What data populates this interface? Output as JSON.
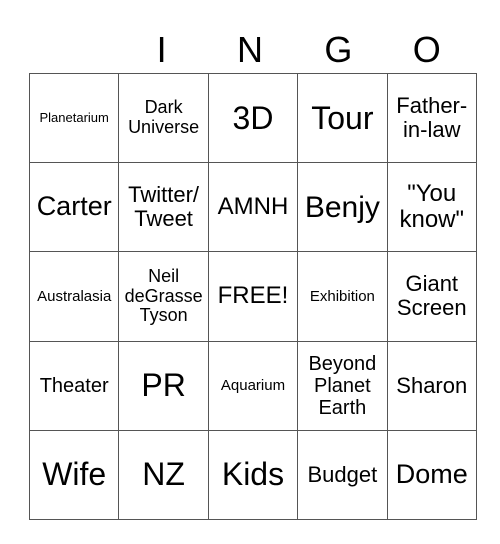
{
  "header": {
    "letters": [
      "",
      "I",
      "N",
      "G",
      "O"
    ]
  },
  "board": {
    "rows": [
      [
        "Planetarium",
        "Dark\nUniverse",
        "3D",
        "Tour",
        "Father-\nin-law"
      ],
      [
        "Carter",
        "Twitter/\nTweet",
        "AMNH",
        "Benjy",
        "\"You\nknow\""
      ],
      [
        "Australasia",
        "Neil\ndeGrasse\nTyson",
        "FREE!",
        "Exhibition",
        "Giant\nScreen"
      ],
      [
        "Theater",
        "PR",
        "Aquarium",
        "Beyond\nPlanet\nEarth",
        "Sharon"
      ],
      [
        "Wife",
        "NZ",
        "Kids",
        "Budget",
        "Dome"
      ]
    ]
  }
}
